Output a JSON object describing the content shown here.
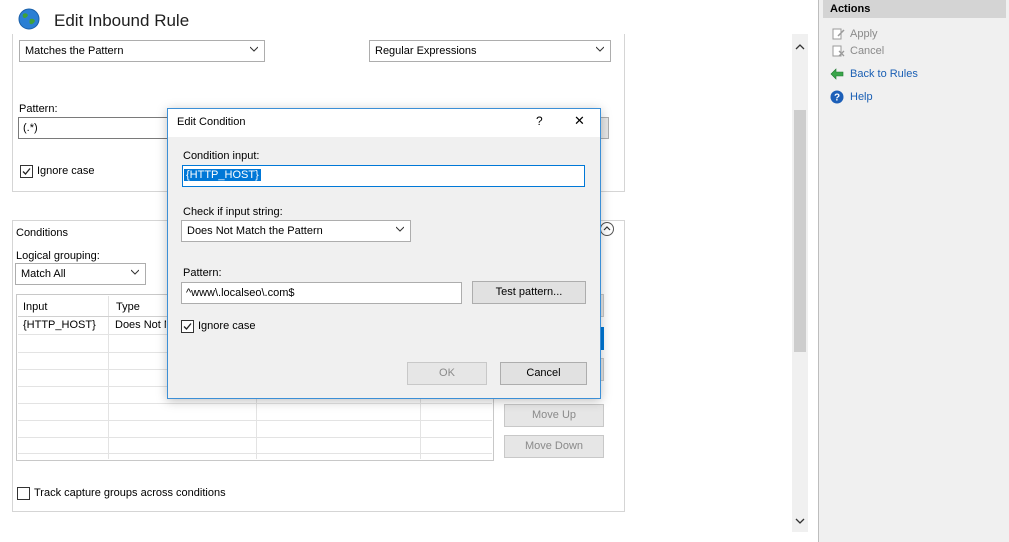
{
  "header": {
    "title": "Edit Inbound Rule"
  },
  "match": {
    "requested_url": "Matches the Pattern",
    "using": "Regular Expressions",
    "pattern_label": "Pattern:",
    "pattern_value": "(.*)",
    "ignore_case_label": "Ignore case"
  },
  "conditions": {
    "title": "Conditions",
    "logical_grouping_label": "Logical grouping:",
    "logical_grouping_value": "Match All",
    "columns": [
      "Input",
      "Type"
    ],
    "rows": [
      {
        "input": "{HTTP_HOST}",
        "type": "Does Not Match the Pattern"
      }
    ],
    "move_up": "Move Up",
    "move_down": "Move Down",
    "track_label": "Track capture groups across conditions"
  },
  "dialog": {
    "title": "Edit Condition",
    "help_glyph": "?",
    "close_glyph": "✕",
    "condition_input_label": "Condition input:",
    "condition_input_value": "{HTTP_HOST}",
    "check_label": "Check if input string:",
    "check_value": "Does Not Match the Pattern",
    "pattern_label": "Pattern:",
    "pattern_value": "^www\\.localseo\\.com$",
    "test_pattern": "Test pattern...",
    "ignore_case_label": "Ignore case",
    "ok": "OK",
    "cancel": "Cancel"
  },
  "actions": {
    "title": "Actions",
    "items": [
      {
        "label": "Apply",
        "icon": "apply-icon",
        "enabled": false
      },
      {
        "label": "Cancel",
        "icon": "cancel-icon",
        "enabled": false
      },
      {
        "label": "Back to Rules",
        "icon": "back-arrow-icon",
        "enabled": true
      },
      {
        "label": "Help",
        "icon": "help-icon",
        "enabled": true
      }
    ]
  },
  "colors": {
    "accent": "#0078d7",
    "link": "#1a5fb4",
    "disabled": "#8a8a8a",
    "selection": "#0078d7",
    "panel_bg": "#f0f0f0"
  }
}
